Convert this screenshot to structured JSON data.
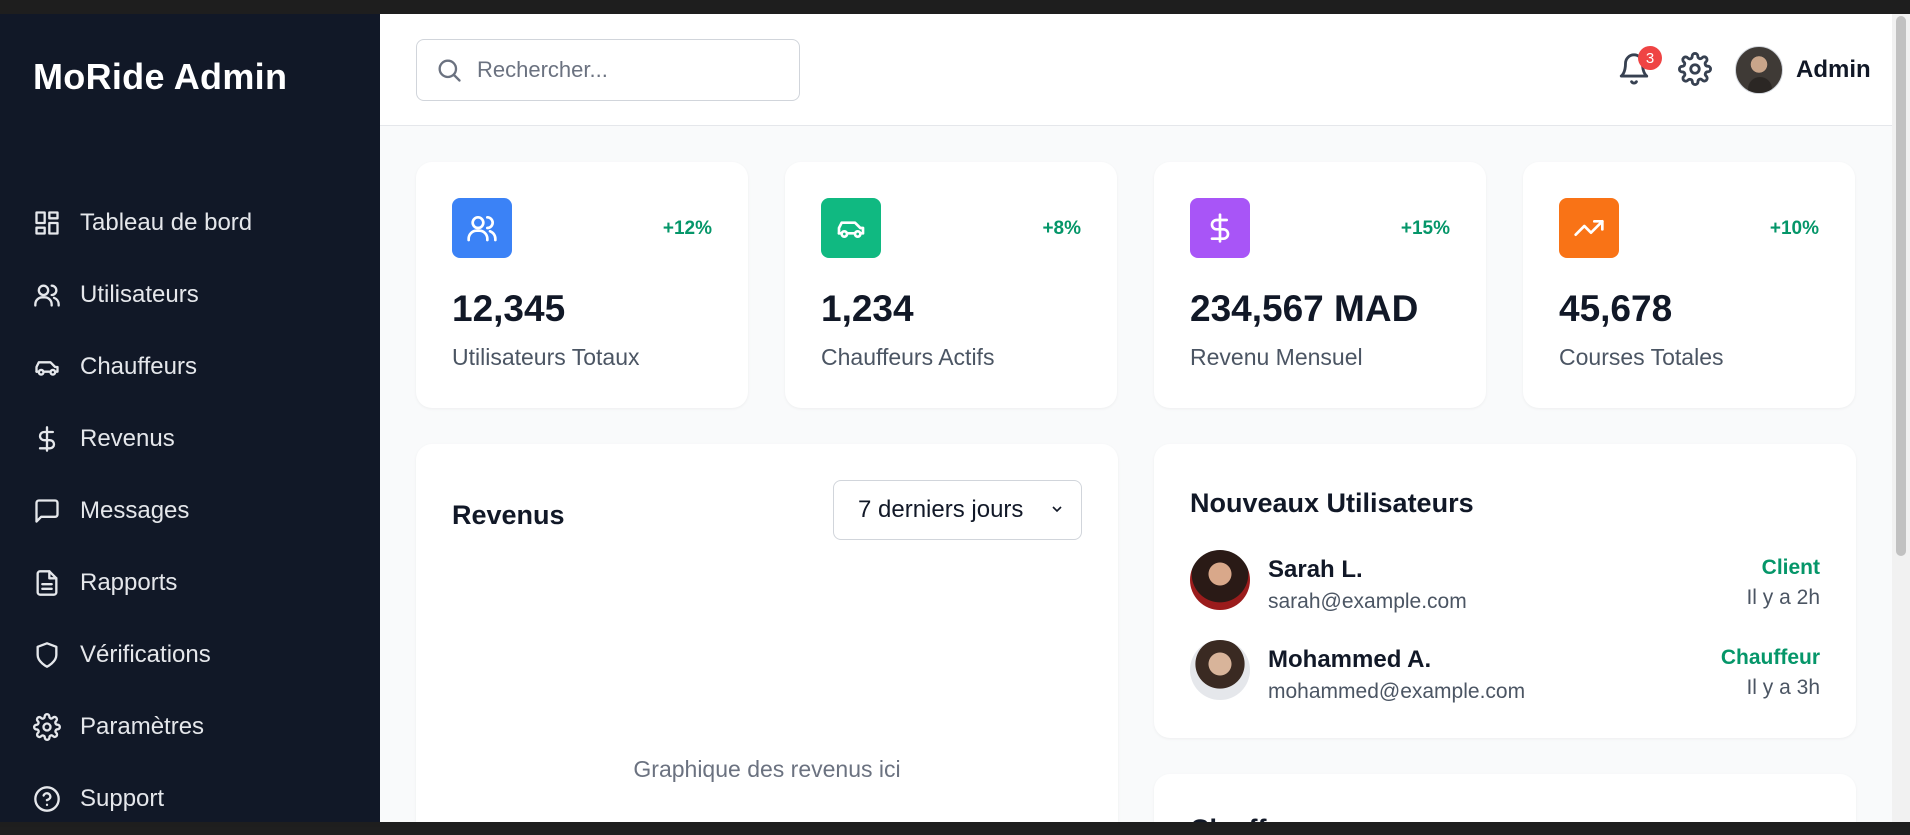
{
  "sidebar": {
    "brand": "MoRide Admin",
    "items": [
      {
        "label": "Tableau de bord",
        "icon": "dashboard-icon"
      },
      {
        "label": "Utilisateurs",
        "icon": "users-icon"
      },
      {
        "label": "Chauffeurs",
        "icon": "car-icon"
      },
      {
        "label": "Revenus",
        "icon": "dollar-icon"
      },
      {
        "label": "Messages",
        "icon": "message-icon"
      },
      {
        "label": "Rapports",
        "icon": "report-icon"
      },
      {
        "label": "Vérifications",
        "icon": "shield-icon"
      },
      {
        "label": "Paramètres",
        "icon": "gear-icon"
      },
      {
        "label": "Support",
        "icon": "help-icon"
      }
    ]
  },
  "header": {
    "search_placeholder": "Rechercher...",
    "notification_count": "3",
    "user_name": "Admin"
  },
  "stats": [
    {
      "value": "12,345",
      "label": "Utilisateurs Totaux",
      "delta": "+12%",
      "icon": "users-icon",
      "color": "#3b82f6"
    },
    {
      "value": "1,234",
      "label": "Chauffeurs Actifs",
      "delta": "+8%",
      "icon": "car-icon",
      "color": "#10b981"
    },
    {
      "value": "234,567 MAD",
      "label": "Revenu Mensuel",
      "delta": "+15%",
      "icon": "dollar-icon",
      "color": "#a855f7"
    },
    {
      "value": "45,678",
      "label": "Courses Totales",
      "delta": "+10%",
      "icon": "trending-up-icon",
      "color": "#f97316"
    }
  ],
  "revenue": {
    "title": "Revenus",
    "period": "7 derniers jours",
    "placeholder": "Graphique des revenus ici"
  },
  "new_users": {
    "title": "Nouveaux Utilisateurs",
    "rows": [
      {
        "name": "Sarah L.",
        "email": "sarah@example.com",
        "role": "Client",
        "time": "Il y a 2h"
      },
      {
        "name": "Mohammed A.",
        "email": "mohammed@example.com",
        "role": "Chauffeur",
        "time": "Il y a 3h"
      }
    ]
  },
  "next_panel": {
    "title_partial": "Ch...ff"
  },
  "colors": {
    "sidebar_bg": "#111827",
    "success": "#059669",
    "badge": "#ef4444"
  }
}
